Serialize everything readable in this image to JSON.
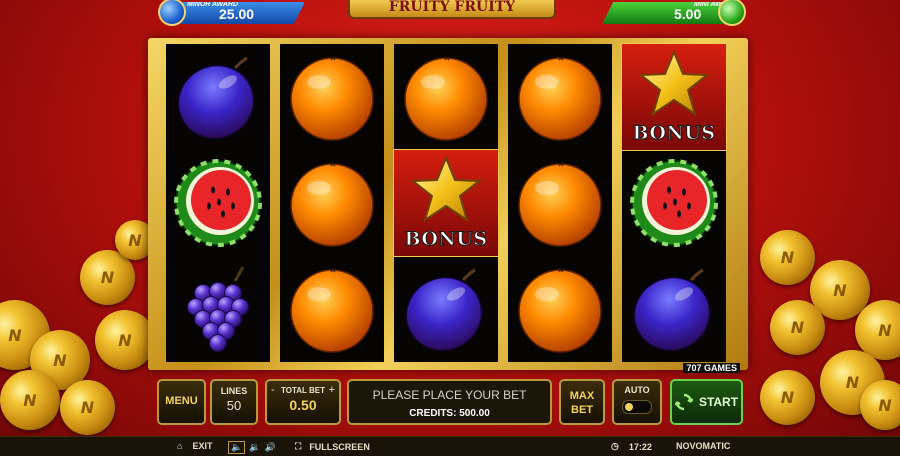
{
  "top": {
    "minor_label": "MINOR AWARD",
    "minor_value": "25.00",
    "mini_label": "MINI AWARD",
    "mini_value": "5.00",
    "logo": "FRUITY FRUITY"
  },
  "reels": [
    [
      "plum",
      "watermelon",
      "grapes"
    ],
    [
      "orange",
      "orange",
      "orange"
    ],
    [
      "orange",
      "bonus-star",
      "plum"
    ],
    [
      "orange",
      "orange",
      "orange"
    ],
    [
      "bonus-star",
      "watermelon",
      "plum"
    ]
  ],
  "bonus_text": "BONUS",
  "provider_badge": "707 GAMES",
  "controls": {
    "menu_label": "MENU",
    "lines_label": "LINES",
    "lines_value": "50",
    "totalbet_label": "TOTAL BET",
    "totalbet_value": "0.50",
    "minus": "-",
    "plus": "+",
    "message": "PLEASE PLACE YOUR BET",
    "credits": "CREDITS: 500.00",
    "maxbet_label": "MAX BET",
    "auto_label": "AUTO",
    "start_label": "START"
  },
  "status": {
    "exit_label": "EXIT",
    "fullscreen_label": "FULLSCREEN",
    "time": "17:22",
    "brand": "NOVOMATIC"
  },
  "colors": {
    "accent_gold": "#f2d35a",
    "start_green": "#6ad04a",
    "background_red": "#b8100c"
  }
}
